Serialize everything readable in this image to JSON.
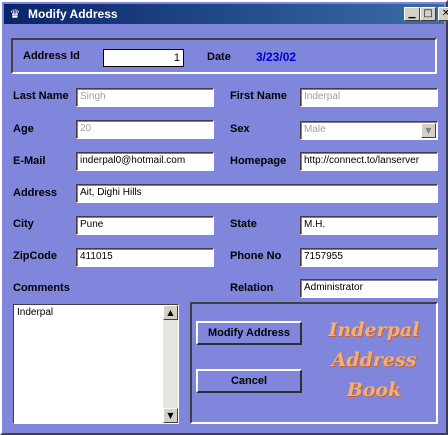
{
  "window": {
    "title": "Modify Address"
  },
  "header": {
    "address_id_label": "Address Id",
    "address_id_value": "1",
    "date_label": "Date",
    "date_value": "3/23/02"
  },
  "form": {
    "last_name": {
      "label": "Last Name",
      "value": "Singh"
    },
    "first_name": {
      "label": "First Name",
      "value": "Inderpal"
    },
    "age": {
      "label": "Age",
      "value": "20"
    },
    "sex": {
      "label": "Sex",
      "value": "Male"
    },
    "email": {
      "label": "E-Mail",
      "value": "inderpal0@hotmail.com"
    },
    "homepage": {
      "label": "Homepage",
      "value": "http://connect.to/lanserver"
    },
    "address": {
      "label": "Address",
      "value": "Ait, Dighi Hills"
    },
    "city": {
      "label": "City",
      "value": "Pune"
    },
    "state": {
      "label": "State",
      "value": "M.H."
    },
    "zipcode": {
      "label": "ZipCode",
      "value": "411015"
    },
    "phone": {
      "label": "Phone No",
      "value": "7157955"
    },
    "comments": {
      "label": "Comments",
      "value": "Inderpal"
    },
    "relation": {
      "label": "Relation",
      "value": "Administrator"
    }
  },
  "actions": {
    "modify_label": "Modify Address",
    "cancel_label": "Cancel"
  },
  "brand": {
    "line1": "Inderpal",
    "line2": "Address",
    "line3": "Book"
  },
  "icons": {
    "app": "app-icon",
    "minimize": "minimize-icon",
    "maximize": "maximize-icon",
    "close": "close-icon"
  },
  "colors": {
    "window_bg": "#7f86dc",
    "titlebar": "#0a246a",
    "date": "#0000cc",
    "brand": "#f5b070"
  }
}
